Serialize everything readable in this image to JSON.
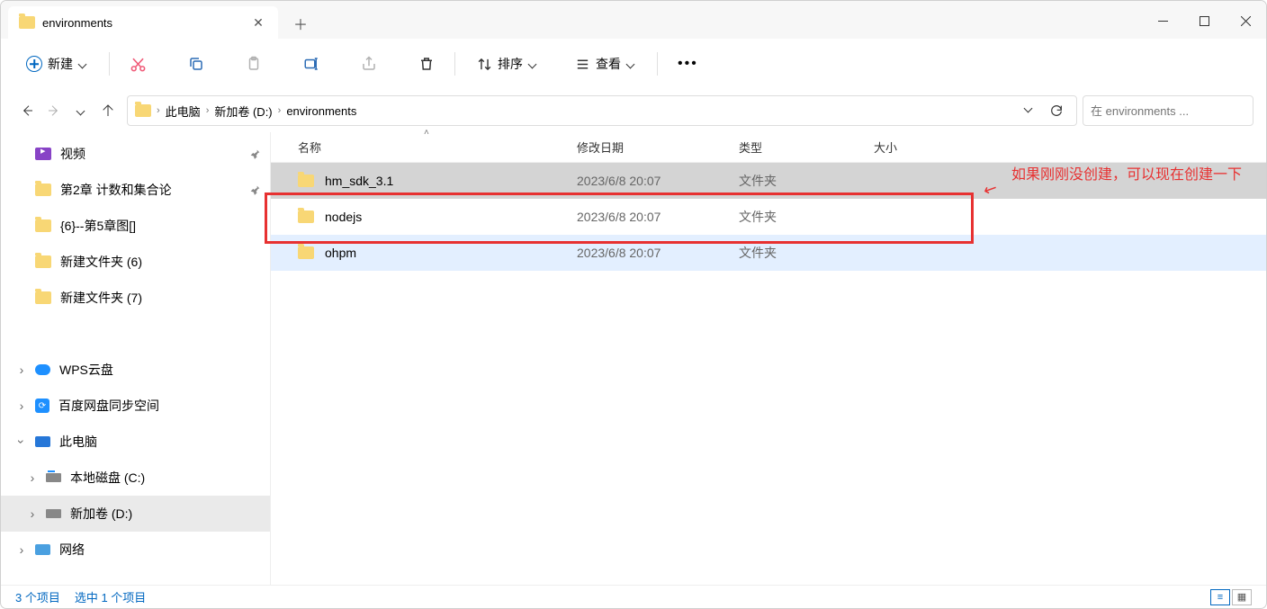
{
  "tab": {
    "title": "environments"
  },
  "toolbar": {
    "new": "新建",
    "sort": "排序",
    "view": "查看"
  },
  "breadcrumbs": [
    "此电脑",
    "新加卷 (D:)",
    "environments"
  ],
  "search": {
    "placeholder": "在 environments ..."
  },
  "sidebar": {
    "quick": [
      {
        "label": "视频",
        "icon": "video",
        "pinned": true
      },
      {
        "label": "第2章 计数和集合论",
        "icon": "folder",
        "pinned": true
      },
      {
        "label": "{6}--第5章图[]",
        "icon": "folder",
        "pinned": false
      },
      {
        "label": "新建文件夹 (6)",
        "icon": "folder",
        "pinned": false
      },
      {
        "label": "新建文件夹 (7)",
        "icon": "folder",
        "pinned": false
      }
    ],
    "drives": [
      {
        "label": "WPS云盘",
        "icon": "cloud"
      },
      {
        "label": "百度网盘同步空间",
        "icon": "baidu"
      }
    ],
    "pc_label": "此电脑",
    "disks": [
      {
        "label": "本地磁盘 (C:)",
        "icon": "diskc"
      },
      {
        "label": "新加卷 (D:)",
        "icon": "disk",
        "selected": true
      }
    ],
    "network_label": "网络"
  },
  "columns": {
    "name": "名称",
    "date": "修改日期",
    "type": "类型",
    "size": "大小"
  },
  "rows": [
    {
      "name": "hm_sdk_3.1",
      "date": "2023/6/8 20:07",
      "type": "文件夹",
      "state": "selected"
    },
    {
      "name": "nodejs",
      "date": "2023/6/8 20:07",
      "type": "文件夹",
      "state": ""
    },
    {
      "name": "ohpm",
      "date": "2023/6/8 20:07",
      "type": "文件夹",
      "state": "hover"
    }
  ],
  "annotation": "如果刚刚没创建，可以现在创建一下",
  "status": {
    "total": "3 个项目",
    "selected": "选中 1 个项目"
  }
}
